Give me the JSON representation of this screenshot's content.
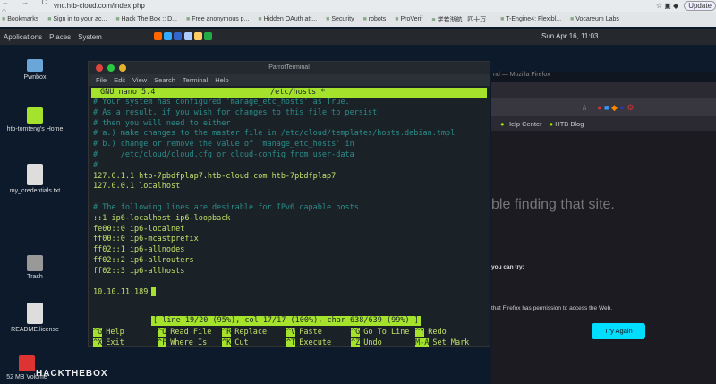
{
  "browser": {
    "url": "vnc.htb-cloud.com/index.php",
    "update_label": "Update",
    "bookmarks": [
      "Bookmarks",
      "Sign in to your ac...",
      "Hack The Box :: D...",
      "Free anonymous p...",
      "Hidden OAuth att...",
      "Security",
      "robots",
      "ProVerif",
      "学若渐航 | 四十万...",
      "T-Engine4: Flexibl...",
      "Vocareum Labs"
    ]
  },
  "panel": {
    "menus": [
      "Applications",
      "Places",
      "System"
    ],
    "clock": "Sun Apr 16, 11:03"
  },
  "desktop": {
    "icons": [
      "Pwnbox",
      "htb-tomteng's Home",
      "my_credentials.txt",
      "Trash",
      "README.license",
      "52 MB Volume"
    ],
    "logo": "HACKTHEBOX"
  },
  "terminal": {
    "title": "ParrotTerminal",
    "menu": [
      "File",
      "Edit",
      "View",
      "Search",
      "Terminal",
      "Help"
    ],
    "nano_version": "GNU nano 5.4",
    "filename": "/etc/hosts *",
    "lines": [
      {
        "t": "c",
        "v": "# Your system has configured 'manage_etc_hosts' as True."
      },
      {
        "t": "c",
        "v": "# As a result, if you wish for changes to this file to persist"
      },
      {
        "t": "c",
        "v": "# then you will need to either"
      },
      {
        "t": "c",
        "v": "# a.) make changes to the master file in /etc/cloud/templates/hosts.debian.tmpl"
      },
      {
        "t": "c",
        "v": "# b.) change or remove the value of 'manage_etc_hosts' in"
      },
      {
        "t": "c",
        "v": "#     /etc/cloud/cloud.cfg or cloud-config from user-data"
      },
      {
        "t": "c",
        "v": "#"
      },
      {
        "t": "t",
        "v": "127.0.1.1 htb-7pbdfplap7.htb-cloud.com htb-7pbdfplap7"
      },
      {
        "t": "t",
        "v": "127.0.0.1 localhost"
      },
      {
        "t": "t",
        "v": " "
      },
      {
        "t": "c",
        "v": "# The following lines are desirable for IPv6 capable hosts"
      },
      {
        "t": "t",
        "v": "::1 ip6-localhost ip6-loopback"
      },
      {
        "t": "t",
        "v": "fe00::0 ip6-localnet"
      },
      {
        "t": "t",
        "v": "ff00::0 ip6-mcastprefix"
      },
      {
        "t": "t",
        "v": "ff02::1 ip6-allnodes"
      },
      {
        "t": "t",
        "v": "ff02::2 ip6-allrouters"
      },
      {
        "t": "t",
        "v": "ff02::3 ip6-allhosts"
      },
      {
        "t": "t",
        "v": " "
      },
      {
        "t": "t",
        "v": "10.10.11.189"
      }
    ],
    "status": "[ line 19/20 (95%), col 17/17 (100%), char 638/639 (99%) ]",
    "shortcuts": [
      [
        "^G",
        "Help"
      ],
      [
        "^O",
        "Read File"
      ],
      [
        "^R",
        "Replace"
      ],
      [
        "^V",
        "Paste"
      ],
      [
        "^G",
        "Go To Line"
      ],
      [
        "^Y",
        "Redo"
      ],
      [
        "^X",
        "Exit"
      ],
      [
        "^F",
        "Where Is"
      ],
      [
        "^K",
        "Cut"
      ],
      [
        "^T",
        "Execute"
      ],
      [
        "^Z",
        "Undo"
      ],
      [
        "M-A",
        "Set Mark"
      ]
    ]
  },
  "firefox": {
    "title": "nd — Mozilla Firefox",
    "bookmarks": [
      "Help Center",
      "HTB Blog"
    ],
    "error_title": "ble finding that site.",
    "try_heading": "you can try:",
    "permission_text": "that Firefox has permission to access the Web.",
    "try_again": "Try Again"
  }
}
